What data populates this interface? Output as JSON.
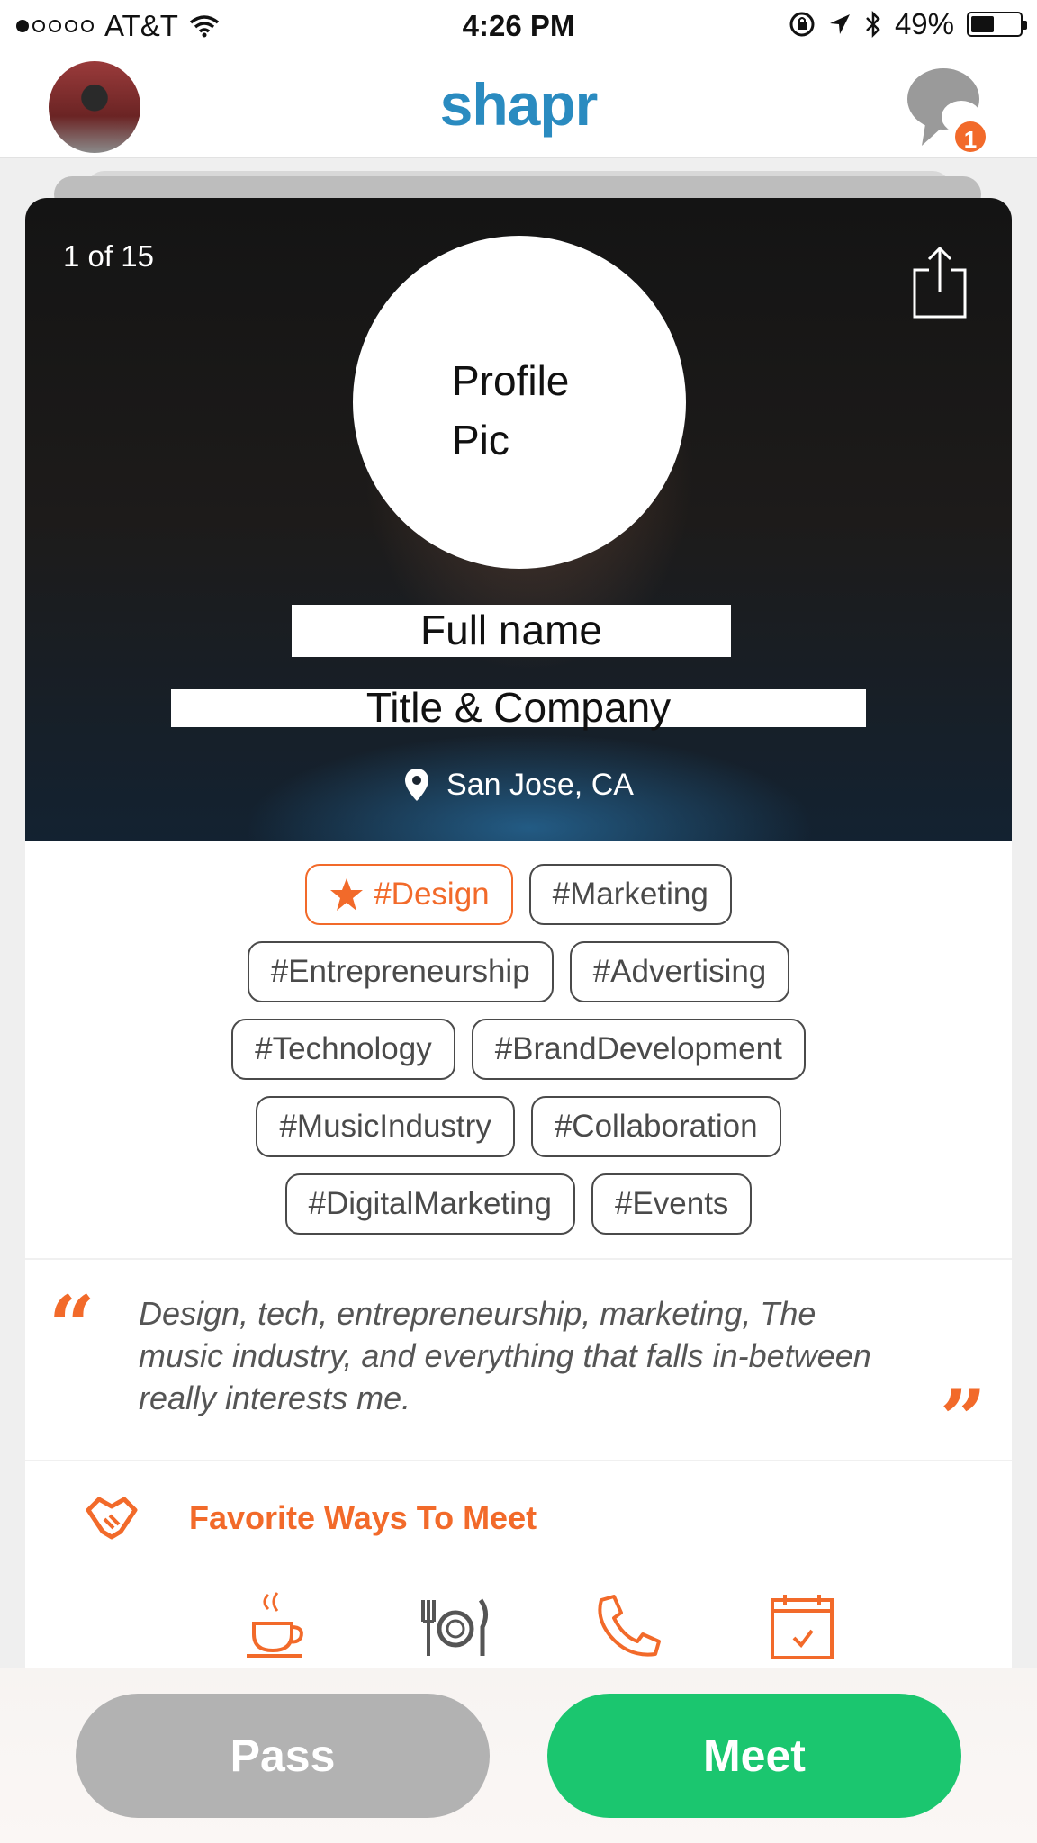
{
  "status_bar": {
    "carrier": "AT&T",
    "time": "4:26 PM",
    "battery": "49%",
    "battery_level": 0.49
  },
  "nav": {
    "brand": "shapr",
    "chat_badge": "1"
  },
  "profile": {
    "counter": "1 of 15",
    "pic_placeholder": "Profile Pic",
    "name": "Full name",
    "title_company": "Title & Company",
    "location": "San Jose, CA"
  },
  "tags": {
    "primary": "#Design",
    "rows": [
      [
        "#Marketing"
      ],
      [
        "#Entrepreneurship",
        "#Advertising"
      ],
      [
        "#Technology",
        "#BrandDevelopment"
      ],
      [
        "#MusicIndustry",
        "#Collaboration"
      ],
      [
        "#DigitalMarketing",
        "#Events"
      ]
    ]
  },
  "quote": {
    "open_mark": "“",
    "close_mark": "”",
    "text": "Design, tech, entrepreneurship, marketing, The music industry, and everything that falls in-between really interests me."
  },
  "ways_to_meet": {
    "title": "Favorite Ways To Meet",
    "icons": [
      "coffee-icon",
      "meal-icon",
      "phone-icon",
      "calendar-icon"
    ]
  },
  "actions": {
    "pass": "Pass",
    "meet": "Meet"
  },
  "colors": {
    "accent": "#f26a2a",
    "brand": "#2a8bc0",
    "meet": "#1bc66f",
    "pass": "#b2b2b2"
  }
}
